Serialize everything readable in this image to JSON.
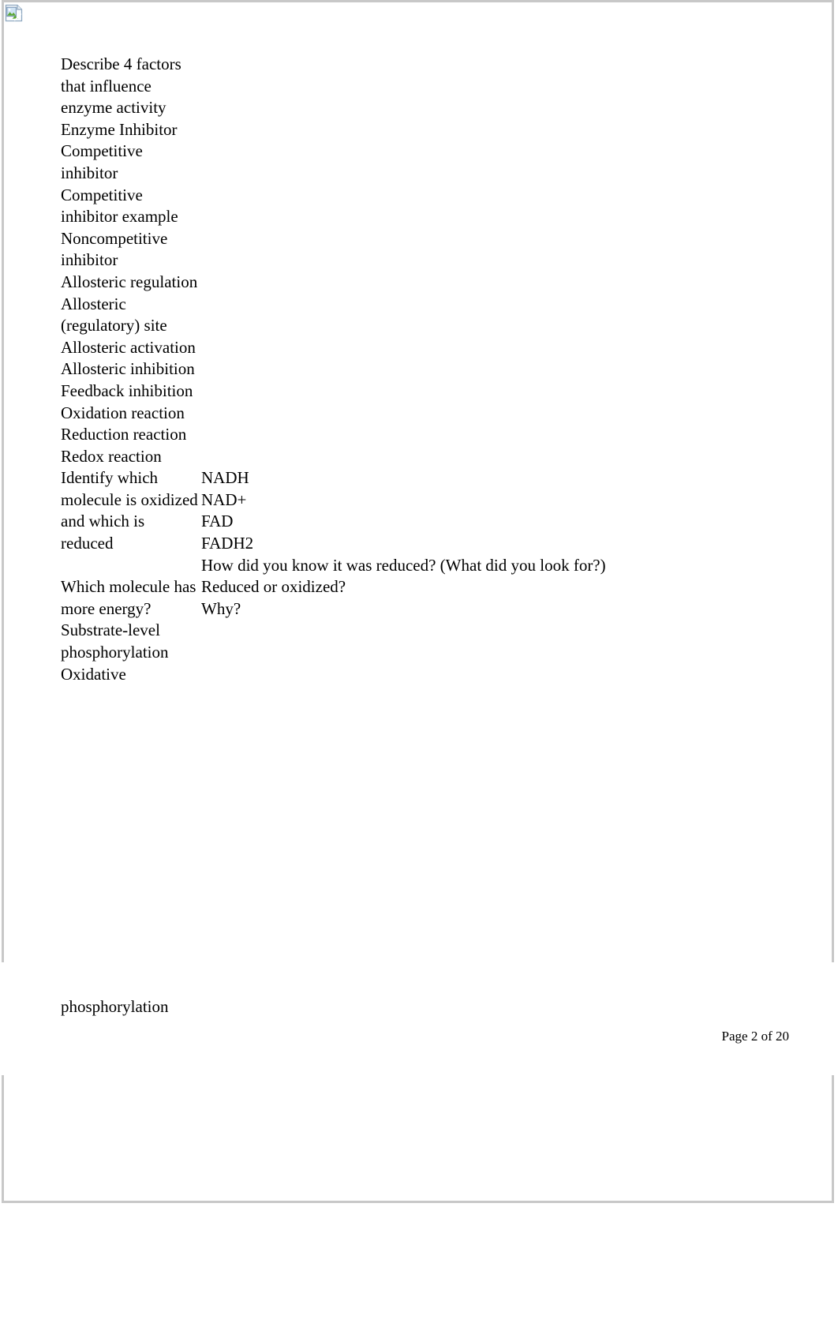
{
  "document": {
    "broken_image_alt": "",
    "footer_text": "Page 2 of 20",
    "continuation_text": "phosphorylation"
  },
  "table": {
    "rows": [
      {
        "term": "Describe 4 factors that influence enzyme activity",
        "answer": ""
      },
      {
        "term": "Enzyme Inhibitor",
        "answer": ""
      },
      {
        "term": "Competitive inhibitor",
        "answer": ""
      },
      {
        "term": "Competitive inhibitor example",
        "answer": ""
      },
      {
        "term": "Noncompetitive inhibitor",
        "answer": ""
      },
      {
        "term": "Allosteric regulation",
        "answer": ""
      },
      {
        "term": "Allosteric (regulatory) site",
        "answer": ""
      },
      {
        "term": "Allosteric activation",
        "answer": ""
      },
      {
        "term": "Allosteric inhibition",
        "answer": ""
      },
      {
        "term": "Feedback inhibition",
        "answer": ""
      },
      {
        "term": "Oxidation reaction",
        "answer": ""
      },
      {
        "term": "Reduction reaction",
        "answer": ""
      },
      {
        "term": "Redox reaction",
        "answer": ""
      },
      {
        "term": "Identify which molecule is oxidized and which is reduced",
        "answer": "NADH\nNAD+\nFAD\nFADH2\nHow did you know it was reduced? (What did you look for?)"
      },
      {
        "term": "Which molecule has more energy?",
        "answer": "Reduced or oxidized?\nWhy?"
      },
      {
        "term": "Substrate-level phosphorylation",
        "answer": ""
      },
      {
        "term": "Oxidative",
        "answer": ""
      }
    ]
  },
  "colors": {
    "page_border": "#c8c8c8",
    "text": "#000000",
    "icon_paper": "#f5f8fb",
    "icon_outline": "#7b96b5",
    "icon_sky": "#bcd6ec",
    "icon_hill": "#5aa832"
  }
}
